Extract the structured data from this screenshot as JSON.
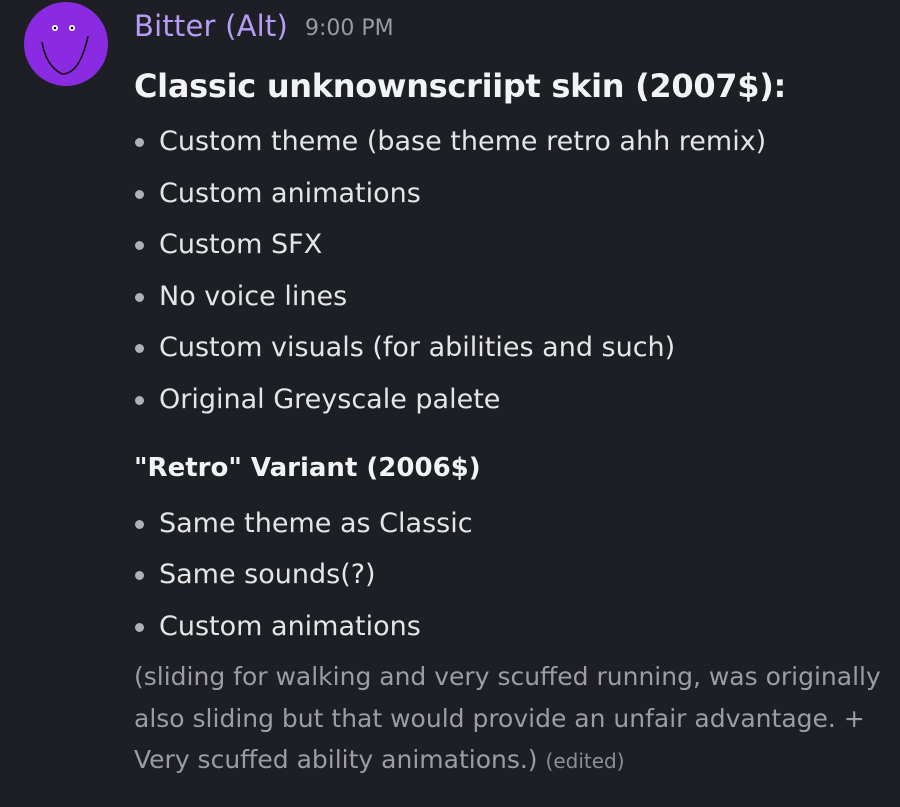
{
  "message": {
    "author": "Bitter (Alt)",
    "timestamp": "9:00 PM",
    "author_color": "#b69cf7",
    "avatar": {
      "icon": "purple-smiley-face-icon",
      "color": "#8a2be2"
    },
    "heading": "Classic unknownscriipt skin (2007$):",
    "list_1": [
      "Custom theme (base theme retro ahh remix)",
      "Custom animations",
      "Custom SFX",
      "No voice lines",
      "Custom visuals (for abilities and such)",
      "Original Greyscale palete"
    ],
    "subheading": "\"Retro\" Variant (2006$)",
    "list_2": [
      "Same theme as Classic",
      "Same sounds(?)",
      "Custom animations"
    ],
    "subtext": "(sliding for walking and very scuffed running, was originally also sliding but that would provide an unfair advantage. + Very scuffed ability animations.)",
    "edited_label": "(edited)"
  }
}
